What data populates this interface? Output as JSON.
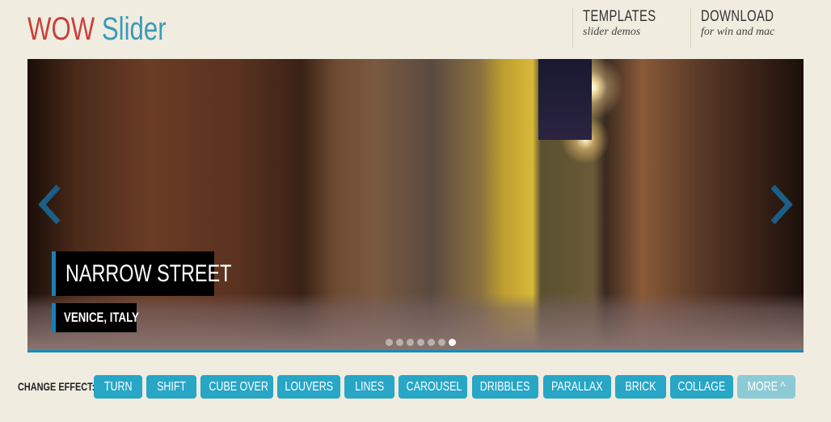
{
  "header": {
    "logo": {
      "part1": "WOW",
      "part2": "Slider"
    },
    "nav": [
      {
        "title": "TEMPLATES",
        "subtitle": "slider demos"
      },
      {
        "title": "DOWNLOAD",
        "subtitle": "for win and mac"
      }
    ]
  },
  "slider": {
    "caption_title": "NARROW STREET",
    "caption_subtitle": "VENICE, ITALY",
    "prev_icon": "chevron-left-icon",
    "next_icon": "chevron-right-icon",
    "dots": 7,
    "active_index": 6,
    "accent": "#1a7fb5"
  },
  "effects": {
    "label": "CHANGE EFFECT:",
    "buttons": [
      "TURN",
      "SHIFT",
      "CUBE OVER",
      "LOUVERS",
      "LINES",
      "CAROUSEL",
      "DRIBBLES",
      "PARALLAX",
      "BRICK",
      "COLLAGE"
    ],
    "more": "MORE ^",
    "button_color": "#27a6c6",
    "more_color": "#8ccbd5",
    "more_disabled": true
  }
}
